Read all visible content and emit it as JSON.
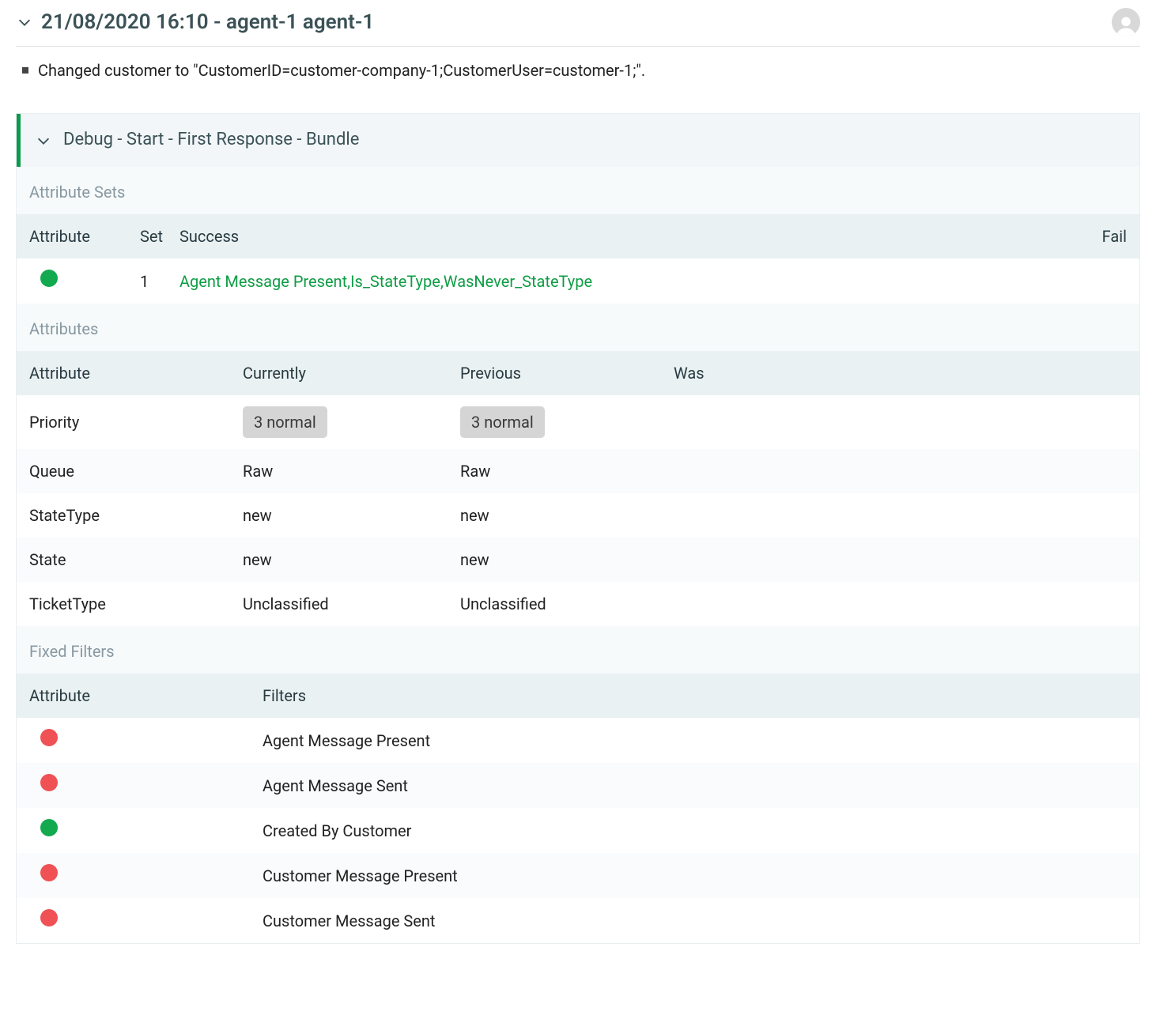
{
  "header": {
    "title": "21/08/2020 16:10 - agent-1 agent-1"
  },
  "changes": [
    "Changed customer to \"CustomerID=customer-company-1;CustomerUser=customer-1;\"."
  ],
  "debug": {
    "title": "Debug - Start - First Response - Bundle"
  },
  "attribute_sets": {
    "section_label": "Attribute Sets",
    "headers": {
      "attribute": "Attribute",
      "set": "Set",
      "success": "Success",
      "fail": "Fail"
    },
    "rows": [
      {
        "status": "green",
        "set": "1",
        "success": "Agent Message Present,Is_StateType,WasNever_StateType",
        "fail": ""
      }
    ]
  },
  "attributes": {
    "section_label": "Attributes",
    "headers": {
      "attribute": "Attribute",
      "currently": "Currently",
      "previous": "Previous",
      "was": "Was"
    },
    "rows": [
      {
        "name": "Priority",
        "currently": "3 normal",
        "previous": "3 normal",
        "was": "",
        "tag": true
      },
      {
        "name": "Queue",
        "currently": "Raw",
        "previous": "Raw",
        "was": "",
        "tag": false
      },
      {
        "name": "StateType",
        "currently": "new",
        "previous": "new",
        "was": "",
        "tag": false
      },
      {
        "name": "State",
        "currently": "new",
        "previous": "new",
        "was": "",
        "tag": false
      },
      {
        "name": "TicketType",
        "currently": "Unclassified",
        "previous": "Unclassified",
        "was": "",
        "tag": false
      }
    ]
  },
  "fixed_filters": {
    "section_label": "Fixed Filters",
    "headers": {
      "attribute": "Attribute",
      "filters": "Filters"
    },
    "rows": [
      {
        "status": "red",
        "filter": "Agent Message Present"
      },
      {
        "status": "red",
        "filter": "Agent Message Sent"
      },
      {
        "status": "green",
        "filter": "Created By Customer"
      },
      {
        "status": "red",
        "filter": "Customer Message Present"
      },
      {
        "status": "red",
        "filter": "Customer Message Sent"
      }
    ]
  }
}
